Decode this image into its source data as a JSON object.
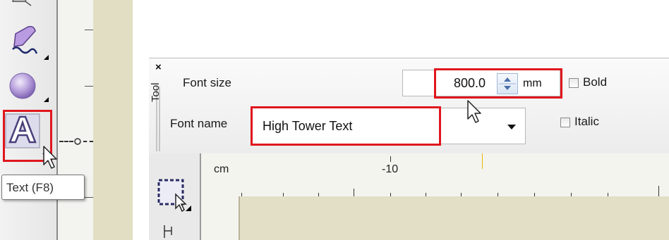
{
  "left_panel": {
    "text_tool_icon": "text-tool-icon",
    "tooltip": "Text (F8)"
  },
  "right_panel": {
    "tool_grip": {
      "close_glyph": "×",
      "label": "Tool"
    },
    "font_size": {
      "label": "Font size",
      "value": "800.0",
      "unit": "mm"
    },
    "font_name": {
      "label": "Font name",
      "value": "High Tower Text"
    },
    "bold": {
      "label": "Bold",
      "checked": false
    },
    "italic": {
      "label": "Italic",
      "checked": false
    },
    "ruler": {
      "unit": "cm",
      "tick_label": "-10"
    }
  },
  "colors": {
    "highlight": "#e0161e",
    "canvas": "#e3dfc6",
    "ruler_marker": "#e8b800"
  }
}
